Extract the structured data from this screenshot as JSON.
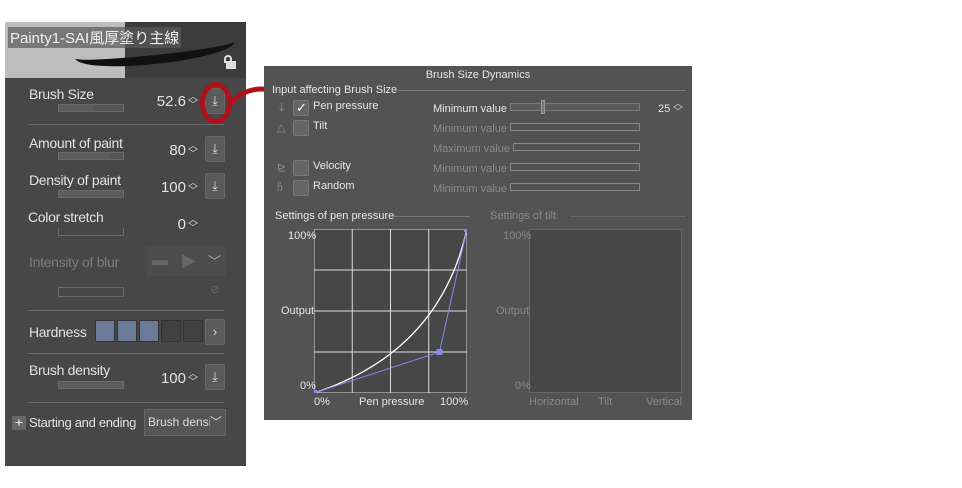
{
  "brush_panel": {
    "title": "Painty1-SAI風厚塗り主線",
    "lock_icon": "unlock-icon",
    "brush_size": {
      "label": "Brush Size",
      "value": "52.6",
      "fill": 0.55
    },
    "amount_of_paint": {
      "label": "Amount of paint",
      "value": "80",
      "fill": 0.8
    },
    "density_of_paint": {
      "label": "Density of paint",
      "value": "100",
      "fill": 1.0
    },
    "color_stretch": {
      "label": "Color stretch",
      "value": "0",
      "fill": 0
    },
    "intensity_of_blur": {
      "label": "Intensity of blur"
    },
    "hardness": {
      "label": "Hardness",
      "level": 3,
      "steps": 5,
      "active_color": "#6b7a99"
    },
    "brush_density": {
      "label": "Brush density",
      "value": "100",
      "fill": 1.0
    },
    "starting_ending": {
      "label": "Starting and ending",
      "selected": "Brush densit"
    }
  },
  "dialog": {
    "title": "Brush Size Dynamics",
    "group_label": "Input affecting Brush Size",
    "inputs": [
      {
        "label": "Pen pressure",
        "checked": true,
        "icon": "pen-pressure-icon",
        "param": "Minimum value",
        "value": "25",
        "fill": 0.25
      },
      {
        "label": "Tilt",
        "checked": false,
        "icon": "tilt-icon",
        "param": "Minimum value",
        "param2": "Maximum value"
      },
      {
        "label": "Velocity",
        "checked": false,
        "icon": "velocity-icon",
        "param": "Minimum value"
      },
      {
        "label": "Random",
        "checked": false,
        "icon": "random-icon",
        "param": "Minimum value"
      }
    ],
    "pressure_graph": {
      "label": "Settings of pen pressure",
      "y_top": "100%",
      "y_mid": "Output",
      "y_bottom": "0%",
      "x_left": "0%",
      "x_mid": "Pen pressure",
      "x_right": "100%",
      "control_point": [
        0.82,
        0.25
      ],
      "curve_color": "#ffffff",
      "handle_color": "#8888ee"
    },
    "tilt_graph": {
      "label": "Settings of tilt",
      "y_top": "100%",
      "y_mid": "Output",
      "y_bottom": "0%",
      "x_left": "Horizontal",
      "x_mid": "Tilt",
      "x_right": "Vertical"
    }
  },
  "annotation_color": "#b0101a"
}
